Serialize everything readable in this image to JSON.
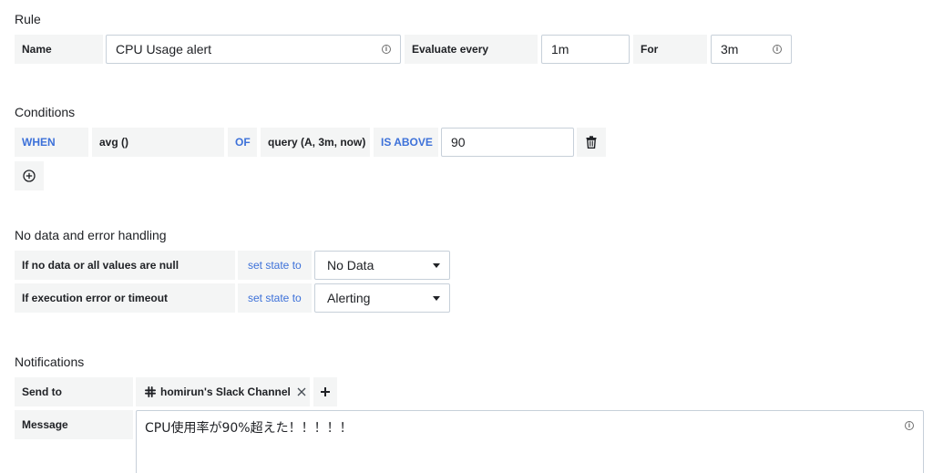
{
  "rule": {
    "title": "Rule",
    "name_label": "Name",
    "name_value": "CPU Usage alert",
    "evaluate_label": "Evaluate every",
    "evaluate_value": "1m",
    "for_label": "For",
    "for_value": "3m"
  },
  "conditions": {
    "title": "Conditions",
    "when_label": "WHEN",
    "reducer": "avg ()",
    "of_label": "OF",
    "query": "query (A, 3m, now)",
    "evaluator_label": "IS ABOVE",
    "threshold": "90"
  },
  "nodata": {
    "title": "No data and error handling",
    "rows": [
      {
        "label": "If no data or all values are null",
        "action": "set state to",
        "value": "No Data"
      },
      {
        "label": "If execution error or timeout",
        "action": "set state to",
        "value": "Alerting"
      }
    ]
  },
  "notifications": {
    "title": "Notifications",
    "send_to_label": "Send to",
    "channel": "homirun's Slack Channel",
    "message_label": "Message",
    "message_value": "CPU使用率が90%超えた！！！！！"
  },
  "icons": {
    "info": "info-icon",
    "trash": "trash-icon",
    "add": "plus-circle-icon",
    "slack": "slack-icon",
    "remove": "close-icon",
    "plus": "plus-icon",
    "caret": "caret-down-icon"
  },
  "colors": {
    "keyword": "#3d71d9",
    "label_bg": "#f4f5f5",
    "border": "#c7d0d9"
  }
}
